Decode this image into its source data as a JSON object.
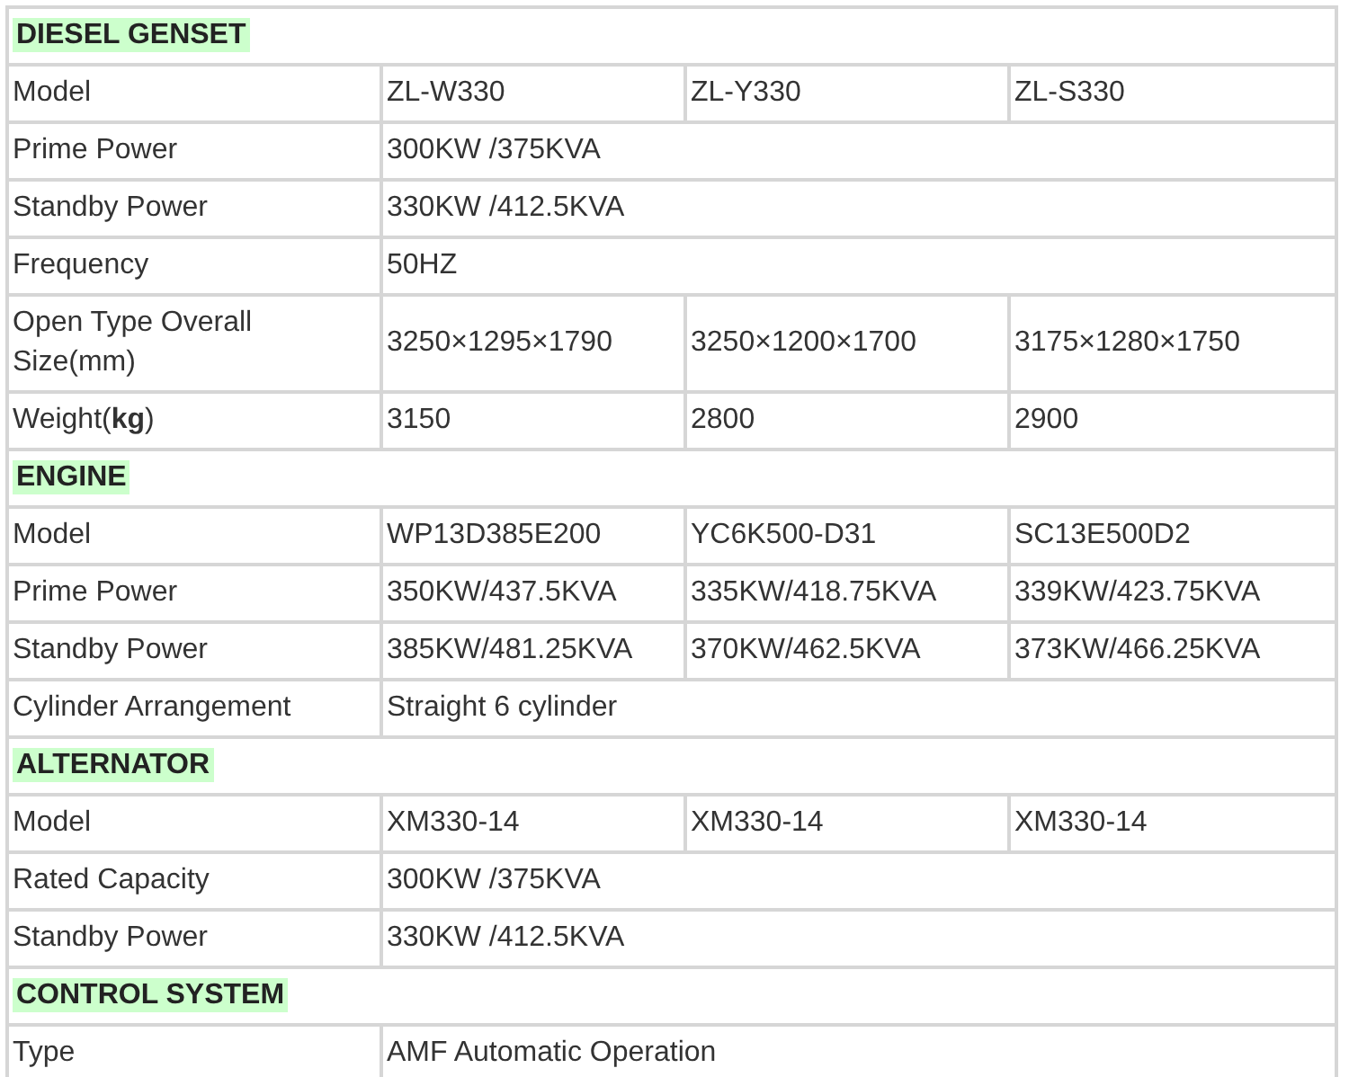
{
  "sections": [
    {
      "title": "DIESEL GENSET",
      "rows": [
        {
          "label": "Model",
          "values": [
            "ZL-W330",
            "ZL-Y330",
            "ZL-S330"
          ]
        },
        {
          "label": "Prime Power",
          "values": [
            "300KW /375KVA"
          ]
        },
        {
          "label": "Standby Power",
          "values": [
            "330KW /412.5KVA"
          ]
        },
        {
          "label": "Frequency",
          "values": [
            "50HZ"
          ]
        },
        {
          "label": "Open Type Overall Size(mm)",
          "values": [
            "3250×1295×1790",
            "3250×1200×1700",
            "3175×1280×1750"
          ]
        },
        {
          "label": "Weight(**kg**)",
          "values": [
            "3150",
            "2800",
            "2900"
          ]
        }
      ]
    },
    {
      "title": "ENGINE",
      "rows": [
        {
          "label": "Model",
          "values": [
            "WP13D385E200",
            "YC6K500-D31",
            "SC13E500D2"
          ]
        },
        {
          "label": "Prime Power",
          "values": [
            "350KW/437.5KVA",
            "335KW/418.75KVA",
            "339KW/423.75KVA"
          ]
        },
        {
          "label": "Standby Power",
          "values": [
            "385KW/481.25KVA",
            "370KW/462.5KVA",
            "373KW/466.25KVA"
          ]
        },
        {
          "label": "Cylinder Arrangement",
          "values": [
            "Straight 6 cylinder"
          ]
        }
      ]
    },
    {
      "title": "ALTERNATOR",
      "rows": [
        {
          "label": "Model",
          "values": [
            "XM330-14",
            "XM330-14",
            "XM330-14"
          ]
        },
        {
          "label": "Rated Capacity",
          "values": [
            "300KW /375KVA"
          ]
        },
        {
          "label": "Standby Power",
          "values": [
            "330KW /412.5KVA"
          ]
        }
      ]
    },
    {
      "title": "CONTROL SYSTEM",
      "rows": [
        {
          "label": "Type",
          "values": [
            "AMF Automatic Operation"
          ]
        }
      ]
    }
  ]
}
